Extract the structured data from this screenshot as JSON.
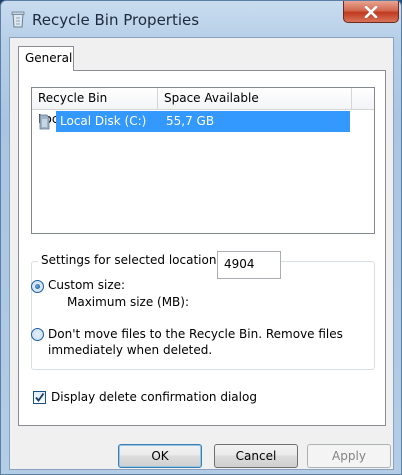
{
  "window": {
    "title": "Recycle Bin Properties"
  },
  "tabs": [
    {
      "label": "General"
    }
  ],
  "list": {
    "columns": [
      "Recycle Bin Location",
      "Space Available"
    ],
    "rows": [
      {
        "location": "Local Disk (C:)",
        "space": "55,7 GB"
      }
    ]
  },
  "settings": {
    "group_label": "Settings for selected location",
    "custom_size_label": "Custom size:",
    "max_size_label": "Maximum size (MB):",
    "max_size_value": "4904",
    "dont_move_line1": "Don't move files to the Recycle Bin. Remove files",
    "dont_move_line2": "immediately when deleted."
  },
  "confirm_dialog_label": "Display delete confirmation dialog",
  "buttons": {
    "ok": "OK",
    "cancel": "Cancel",
    "apply": "Apply"
  },
  "colors": {
    "selection": "#3399ff",
    "close_button": "#c8462a"
  },
  "icons": {
    "title": "recycle-bin-icon",
    "drive": "drive-icon",
    "close": "close-icon",
    "check": "checkmark-icon"
  }
}
